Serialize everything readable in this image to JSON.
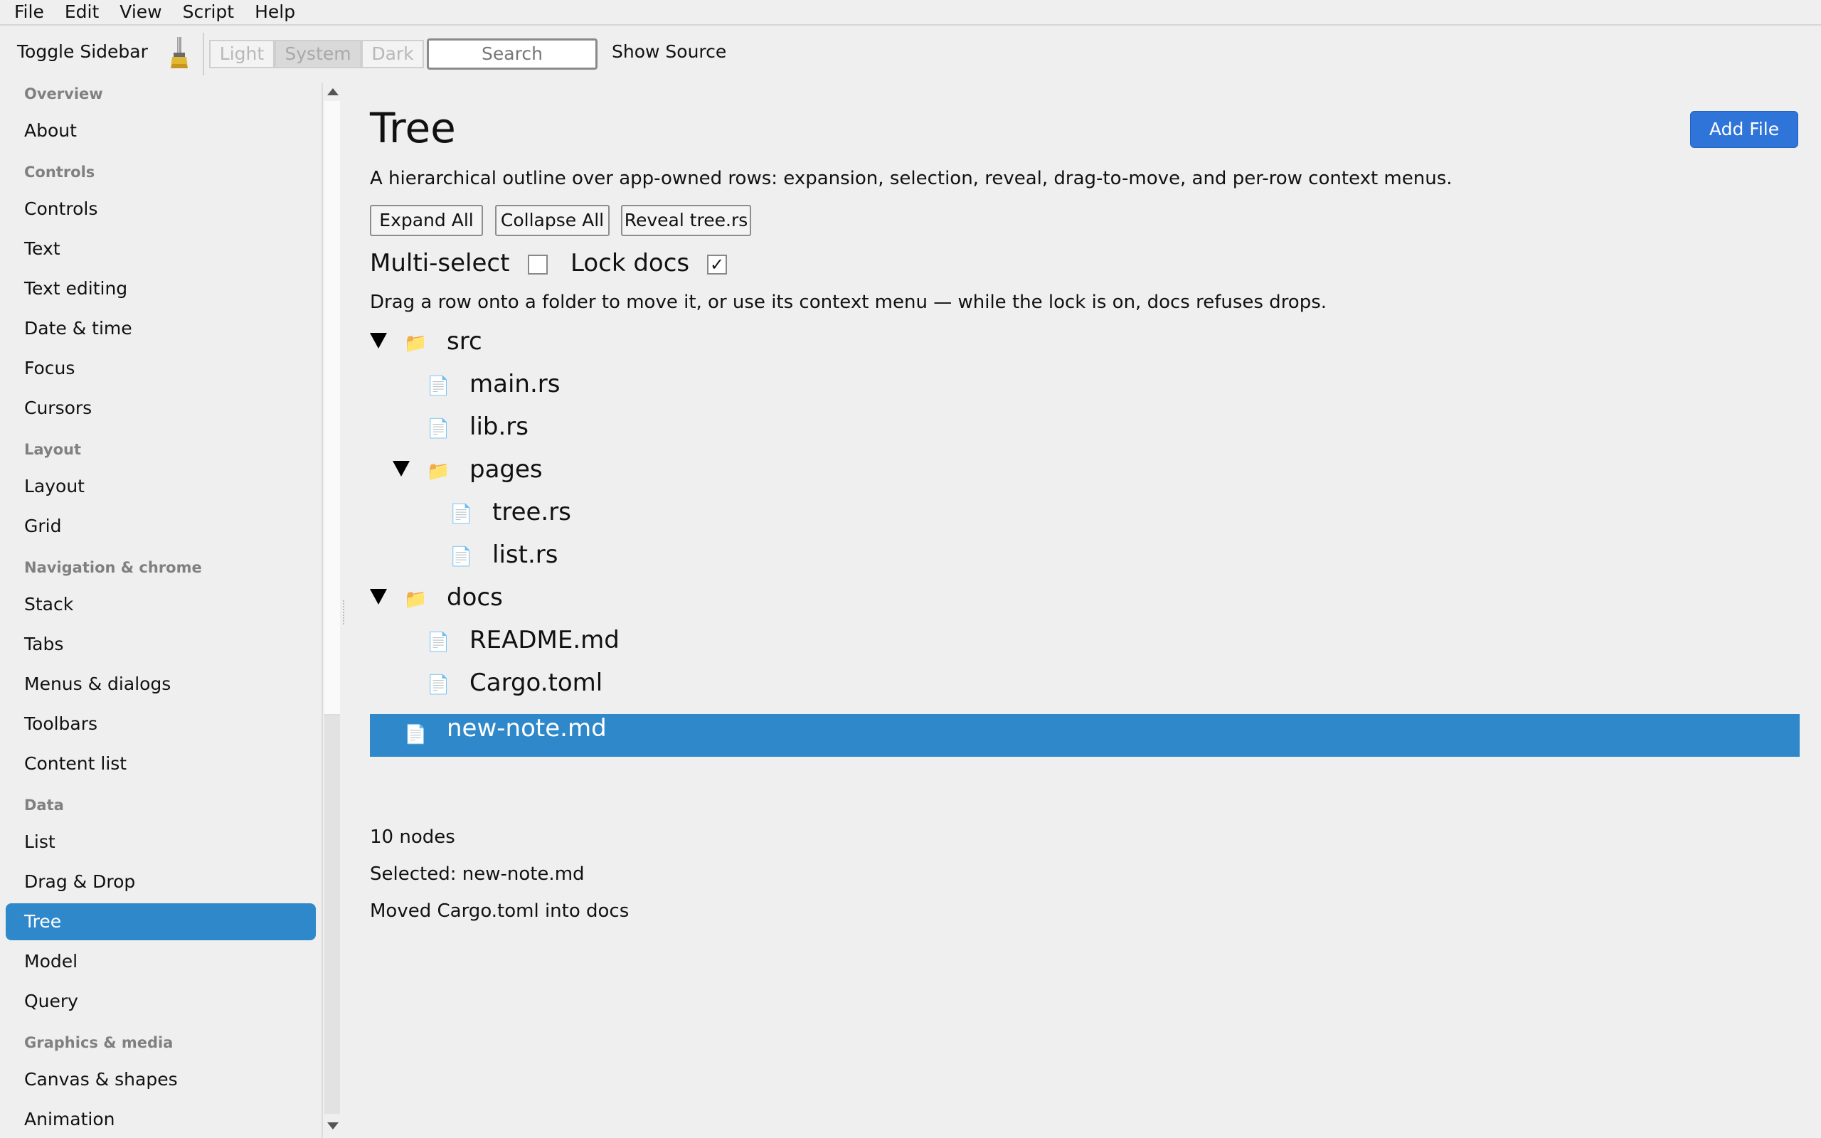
{
  "menubar": {
    "items": [
      "File",
      "Edit",
      "View",
      "Script",
      "Help"
    ]
  },
  "toolbar": {
    "toggle_sidebar": "Toggle Sidebar",
    "theme": {
      "light": "Light",
      "system": "System",
      "dark": "Dark",
      "selected": "System"
    },
    "search_placeholder": "Search",
    "show_source": "Show Source"
  },
  "sidebar": {
    "sections": [
      {
        "header": "Overview",
        "items": [
          "About"
        ]
      },
      {
        "header": "Controls",
        "items": [
          "Controls",
          "Text",
          "Text editing",
          "Date & time",
          "Focus",
          "Cursors"
        ]
      },
      {
        "header": "Layout",
        "items": [
          "Layout",
          "Grid"
        ]
      },
      {
        "header": "Navigation & chrome",
        "items": [
          "Stack",
          "Tabs",
          "Menus & dialogs",
          "Toolbars",
          "Content list"
        ]
      },
      {
        "header": "Data",
        "items": [
          "List",
          "Drag & Drop",
          "Tree",
          "Model",
          "Query"
        ]
      },
      {
        "header": "Graphics & media",
        "items": [
          "Canvas & shapes",
          "Animation"
        ]
      }
    ],
    "selected": "Tree"
  },
  "main": {
    "title": "Tree",
    "add_file": "Add File",
    "description": "A hierarchical outline over app-owned rows: expansion, selection, reveal, drag-to-move, and per-row context menus.",
    "buttons": {
      "expand_all": "Expand All",
      "collapse_all": "Collapse All",
      "reveal": "Reveal tree.rs"
    },
    "options": {
      "multi_select": "Multi-select",
      "multi_select_checked": false,
      "lock_docs": "Lock docs",
      "lock_docs_checked": true,
      "check_mark": "✓"
    },
    "hint": "Drag a row onto a folder to move it, or use its context menu — while the lock is on, docs refuses drops.",
    "tree": [
      {
        "label": "src",
        "type": "folder",
        "depth": 0,
        "expanded": true
      },
      {
        "label": "main.rs",
        "type": "file",
        "depth": 1
      },
      {
        "label": "lib.rs",
        "type": "file",
        "depth": 1
      },
      {
        "label": "pages",
        "type": "folder",
        "depth": 1,
        "expanded": true
      },
      {
        "label": "tree.rs",
        "type": "file",
        "depth": 2
      },
      {
        "label": "list.rs",
        "type": "file",
        "depth": 2
      },
      {
        "label": "docs",
        "type": "folder",
        "depth": 0,
        "expanded": true
      },
      {
        "label": "README.md",
        "type": "file",
        "depth": 1
      },
      {
        "label": "Cargo.toml",
        "type": "file",
        "depth": 1
      },
      {
        "label": "new-note.md",
        "type": "file",
        "depth": 0,
        "selected": true
      }
    ],
    "status": {
      "count": "10 nodes",
      "selected": "Selected: new-note.md",
      "last_action": "Moved Cargo.toml into docs"
    }
  },
  "colors": {
    "accent": "#2f88c9",
    "primary_button": "#2f74d8",
    "folder": "#e8b53a"
  },
  "icons": {
    "folder": "folder-icon",
    "file": "file-icon",
    "brush": "brush-icon"
  }
}
